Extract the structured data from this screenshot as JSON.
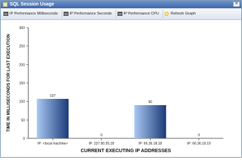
{
  "window": {
    "title": "SQL Session Usage",
    "close_label": "✕"
  },
  "toolbar": {
    "items": [
      {
        "label": "IP Performance Milliseconds",
        "icon": "grid-icon"
      },
      {
        "label": "IP Performance Seconds",
        "icon": "grid-icon"
      },
      {
        "label": "IP Performance CPU",
        "icon": "grid-icon"
      },
      {
        "label": "Refresh Graph",
        "icon": "refresh-icon"
      }
    ]
  },
  "chart_data": {
    "type": "bar",
    "title": "",
    "xlabel": "CURRENT EXECUTING IP ADDRESSES",
    "ylabel": "TIME IN MILLISECONDS FOR LAST EXECUTION",
    "categories": [
      "IP: <local machine>",
      "IP: 237.90.55.18",
      "IP: 66.36.18.18",
      "IP: 66.36.18.19"
    ],
    "values": [
      107,
      0,
      90,
      0
    ],
    "ylim": [
      0,
      300
    ],
    "yticks": [
      0,
      50,
      100,
      150,
      200,
      250,
      300
    ],
    "grid": false,
    "colors": {
      "bar_light": "#a9c8f3",
      "bar_dark": "#1b3a78"
    }
  }
}
